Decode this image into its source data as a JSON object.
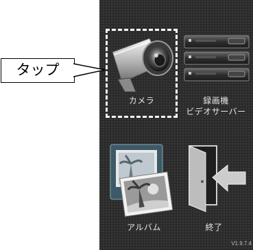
{
  "annotation": {
    "callout_text": "タップ"
  },
  "menu": {
    "camera_label": "カメラ",
    "recorder_label_line1": "録画機",
    "recorder_label_line2": "ビデオサーバー",
    "album_label": "アルバム",
    "exit_label": "終了"
  },
  "footer": {
    "version": "V1.9.7.4"
  },
  "icons": {
    "camera": "security-camera-icon",
    "recorder": "dvr-stack-icon",
    "album": "photo-album-icon",
    "exit": "exit-door-icon"
  }
}
